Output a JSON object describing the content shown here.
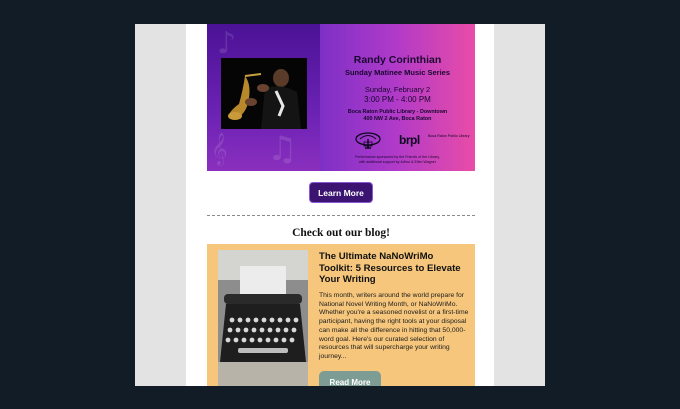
{
  "event": {
    "performer": "Randy Corinthian",
    "series": "Sunday Matinee Music Series",
    "date": "Sunday, February 2",
    "time": "3:00 PM - 4:00 PM",
    "venue_line1": "Boca Raton Public Library - Downtown",
    "venue_line2": "400 NW 2 Ave, Boca Raton",
    "logo_text": "brpl",
    "logo_subtext": "Boca Raton Public Library",
    "credit_line1": "Performance sponsored by the Friends of the Library,",
    "credit_line2": "with additional support by Arthur & Ellen Wagner",
    "learn_more_label": "Learn More"
  },
  "blog": {
    "heading": "Check out our blog!",
    "title": "The Ultimate NaNoWriMo Toolkit: 5 Resources to Elevate Your Writing",
    "body": "This month, writers around the world prepare for National Novel Writing Month, or NaNoWriMo. Whether you're a seasoned novelist or a first-time participant, having the right tools at your disposal can make all the difference in hitting that 50,000-word goal. Here's our curated selection of resources that will supercharge your writing journey...",
    "read_more_label": "Read More"
  },
  "colors": {
    "page_background": "#111c27",
    "banner_gradient_start": "#5a1a9a",
    "banner_gradient_end": "#e94ca7",
    "learn_more_button": "#3a1470",
    "blog_card": "#f5c67c",
    "read_more_button": "#7c9c94"
  }
}
